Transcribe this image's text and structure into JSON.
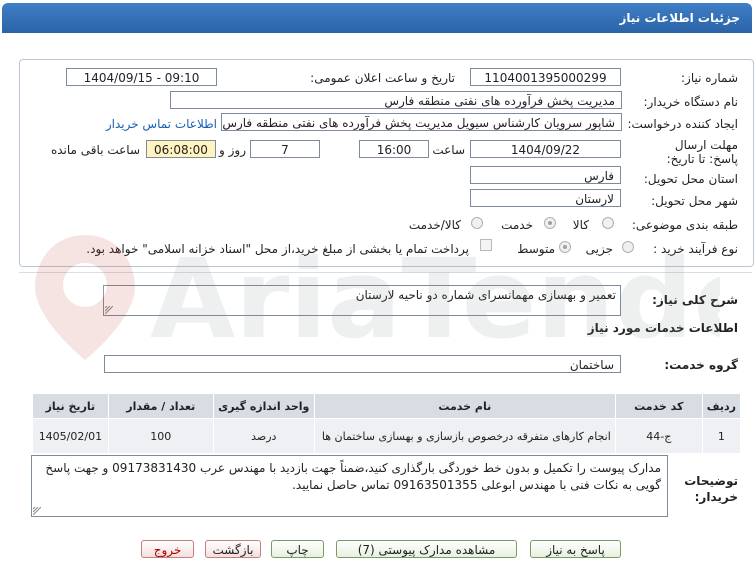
{
  "header": {
    "title": "جزئیات اطلاعات نیاز"
  },
  "form": {
    "need_number_label": "شماره نیاز:",
    "need_number": "1104001395000299",
    "announce_label": "تاریخ و ساعت اعلان عمومی:",
    "announce_value": "1404/09/15 - 09:10",
    "buyer_label": "نام دستگاه خریدار:",
    "buyer_value": "مدیریت پخش فرآورده های نفتی منطقه فارس",
    "creator_label": "ایجاد کننده درخواست:",
    "creator_value": "شاپور سرویان کارشناس سیویل مدیریت پخش فرآورده های نفتی منطقه فارس",
    "contact_link": "اطلاعات تماس خریدار",
    "deadline_label": "مهلت ارسال پاسخ: تا تاریخ:",
    "deadline_date": "1404/09/22",
    "time_label": "ساعت",
    "deadline_time": "16:00",
    "days_value": "7",
    "days_label": "روز و",
    "remaining_value": "06:08:00",
    "remaining_label": "ساعت باقی مانده",
    "province_label": "استان محل تحویل:",
    "province_value": "فارس",
    "city_label": "شهر محل تحویل:",
    "city_value": "لارستان",
    "category_label": "طبقه بندی موضوعی:",
    "category_options": [
      "کالا",
      "خدمت",
      "کالا/خدمت"
    ],
    "category_selected": "خدمت",
    "process_label": "نوع فرآیند خرید :",
    "process_options": [
      "جزیی",
      "متوسط"
    ],
    "process_selected": "متوسط",
    "treasury_note": "پرداخت تمام یا بخشی از مبلغ خرید،از محل \"اسناد خزانه اسلامی\" خواهد بود."
  },
  "summary": {
    "label": "شرح کلی نیاز:",
    "value": "تعمیر و بهسازی مهمانسرای شماره دو ناحیه لارستان"
  },
  "services": {
    "section_title": "اطلاعات خدمات مورد نیاز",
    "group_label": "گروه خدمت:",
    "group_value": "ساختمان",
    "columns": [
      "ردیف",
      "کد خدمت",
      "نام خدمت",
      "واحد اندازه گیری",
      "تعداد / مقدار",
      "تاریخ نیاز"
    ],
    "rows": [
      {
        "row": "1",
        "code": "ج-44",
        "name": "انجام کارهای متفرقه درخصوص بازسازی و بهسازی ساختمان ها",
        "unit": "درصد",
        "qty": "100",
        "date": "1405/02/01"
      }
    ]
  },
  "notes": {
    "label": "توضیحات خریدار:",
    "text": "مدارک پیوست را تکمیل و بدون خط خوردگی بارگذاری کنید،ضمناً جهت بازدید با مهندس عرب 09173831430 و جهت پاسخ گویی به نکات فنی با مهندس ابوعلی 09163501355 تماس حاصل نمایید."
  },
  "buttons": {
    "reply": "پاسخ به نیاز",
    "attachments": "مشاهده مدارک پیوستی (7)",
    "print": "چاپ",
    "back": "بازگشت",
    "exit": "خروج"
  },
  "watermark": {
    "text": "AriaTender.neT"
  },
  "colors": {
    "header": "#2a63a8",
    "highlight": "#fff3c0",
    "link": "#1a5fb4"
  }
}
